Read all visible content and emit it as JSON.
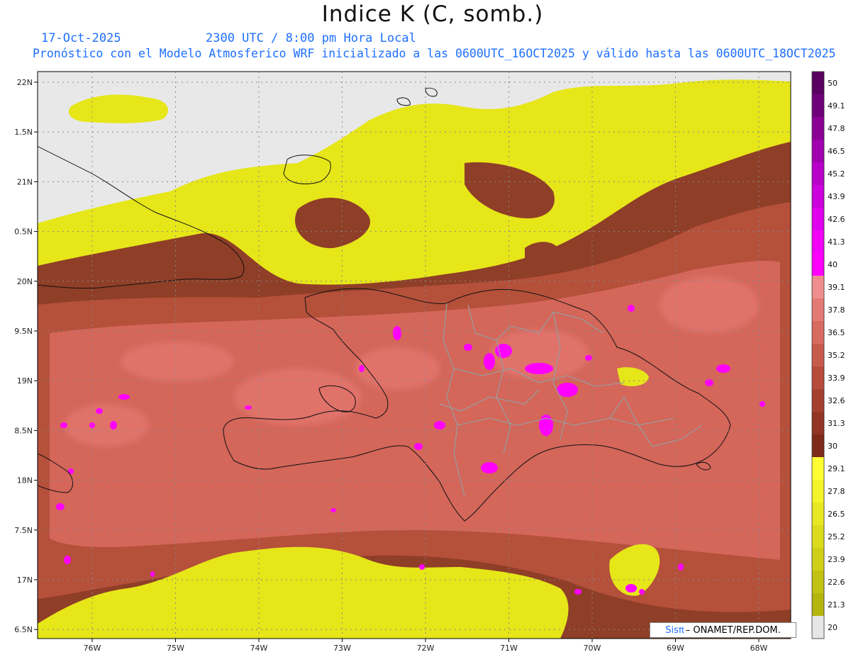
{
  "header": {
    "title": "Indice K (C, somb.)",
    "date": "17-Oct-2025",
    "time": "2300 UTC / 8:00 pm Hora Local",
    "model": "Pronóstico con el Modelo Atmosferico WRF inicializado a las 0600UTC_16OCT2025 y válido hasta las  0600UTC_18OCT2025"
  },
  "map": {
    "lat_labels": [
      "22N",
      "1.5N",
      "21N",
      "0.5N",
      "20N",
      "9.5N",
      "19N",
      "8.5N",
      "18N",
      "7.5N",
      "17N",
      "6.5N"
    ],
    "lon_labels": [
      "76W",
      "75W",
      "74W",
      "73W",
      "72W",
      "71W",
      "70W",
      "69W",
      "68W"
    ],
    "colors": {
      "background": "#e8e8e8",
      "low_yellow": "#e6e619",
      "band_dark": "#8f3e27",
      "band_mid": "#b5503b",
      "band_light": "#d4665a",
      "pink": "#e0726b",
      "magenta": "#ff00ff",
      "coast": "#111111",
      "provinces": "#9a9a9a"
    }
  },
  "colorbar": {
    "labels": [
      "50",
      "49.1",
      "47.8",
      "46.5",
      "45.2",
      "43.9",
      "42.6",
      "41.3",
      "40",
      "39.1",
      "37.8",
      "36.5",
      "35.2",
      "33.9",
      "32.6",
      "31.3",
      "30",
      "29.1",
      "27.8",
      "26.5",
      "25.2",
      "23.9",
      "22.6",
      "21.3",
      "20"
    ],
    "colors": [
      "#5a0060",
      "#70007a",
      "#8a0095",
      "#a000b0",
      "#b800c8",
      "#cc00dc",
      "#e000ee",
      "#f200f8",
      "#ff00ff",
      "#ee8e8e",
      "#e47a74",
      "#d96a62",
      "#c85a4c",
      "#b84c3c",
      "#a5402f",
      "#923524",
      "#7e2a1a",
      "#ffff33",
      "#f4f42a",
      "#e8e822",
      "#dcdc1c",
      "#cfcf18",
      "#c2c214",
      "#b5b510",
      "#e6e6e6"
    ]
  },
  "credit": {
    "brand": "Sisπ",
    "text": "– ONAMET/REP.DOM."
  }
}
